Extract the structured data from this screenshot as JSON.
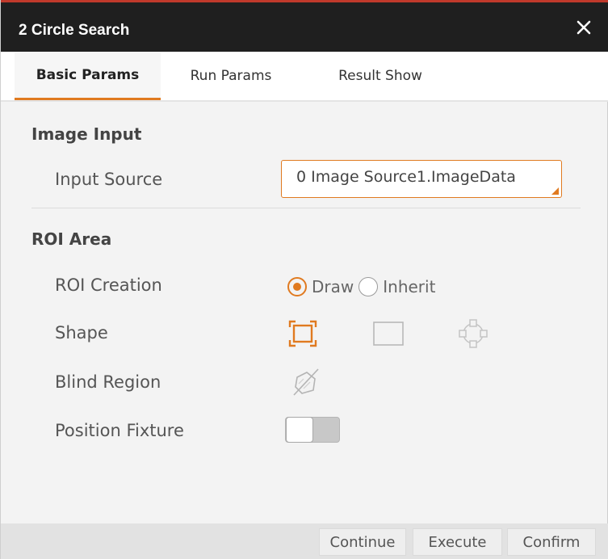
{
  "dialog": {
    "title": "2 Circle Search",
    "accent_color": "#e07a20",
    "titlebar_color": "#1f1f1f"
  },
  "tabs": [
    {
      "label": "Basic Params",
      "active": true
    },
    {
      "label": "Run Params",
      "active": false
    },
    {
      "label": "Result Show",
      "active": false
    }
  ],
  "image_input": {
    "section_title": "Image Input",
    "input_source_label": "Input Source",
    "input_source_value": "0 Image Source1.ImageData"
  },
  "roi_area": {
    "section_title": "ROI Area",
    "roi_creation_label": "ROI Creation",
    "roi_options": [
      {
        "label": "Draw",
        "selected": true
      },
      {
        "label": "Inherit",
        "selected": false
      }
    ],
    "shape_label": "Shape",
    "shape_icons": [
      "bounding-box-icon",
      "rectangle-icon",
      "crosshair-shape-icon"
    ],
    "blind_region_label": "Blind Region",
    "blind_region_icon": "blind-region-icon",
    "position_fixture_label": "Position Fixture",
    "position_fixture_on": false
  },
  "footer": {
    "continue_label": "Continue",
    "execute_label": "Execute",
    "confirm_label": "Confirm"
  }
}
